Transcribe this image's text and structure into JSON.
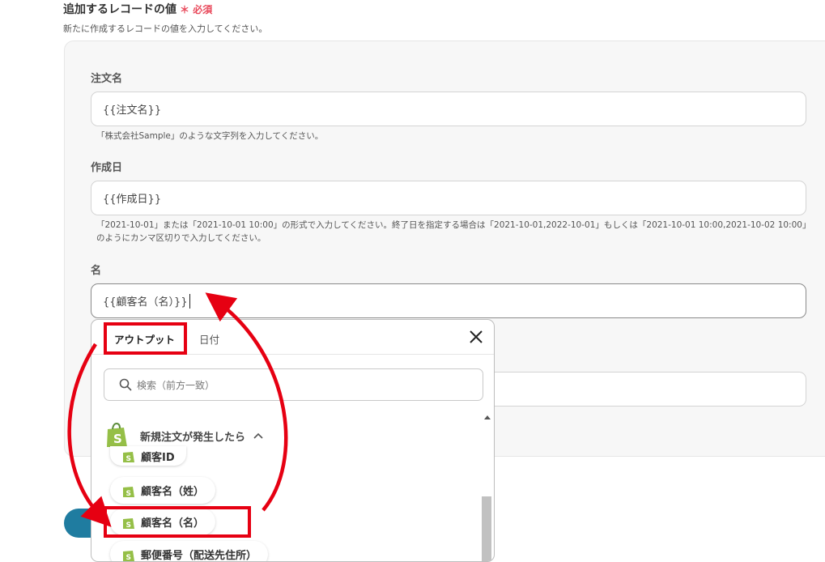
{
  "section": {
    "title": "追加するレコードの値",
    "required_mark": "＊",
    "required_text": "必須",
    "description": "新たに作成するレコードの値を入力してください。"
  },
  "fields": [
    {
      "label": "注文名",
      "value": "{{注文名}}",
      "hint": "「株式会社Sample」のような文字列を入力してください。"
    },
    {
      "label": "作成日",
      "value": "{{作成日}}",
      "hint": "「2021-10-01」または「2021-10-01 10:00」の形式で入力してください。終了日を指定する場合は「2021-10-01,2022-10-01」もしくは「2021-10-01 10:00,2021-10-02 10:00」のようにカンマ区切りで入力してください。"
    },
    {
      "label": "名",
      "value": "{{顧客名（名）}}"
    }
  ],
  "popup": {
    "tabs": [
      "アウトプット",
      "日付"
    ],
    "search_placeholder": "検索（前方一致）",
    "group_label": "新規注文が発生したら",
    "items": [
      "顧客ID",
      "顧客名（姓）",
      "顧客名（名）",
      "郵便番号（配送先住所）"
    ]
  },
  "icons": {
    "close": "close-icon",
    "search": "search-icon",
    "shopify": "shopify-bag-icon",
    "chevron": "chevron-up-icon"
  },
  "colors": {
    "accent": "#1f7ca0",
    "required": "#e8485a",
    "annotation": "#e60012",
    "shopify": "#95bf47"
  }
}
